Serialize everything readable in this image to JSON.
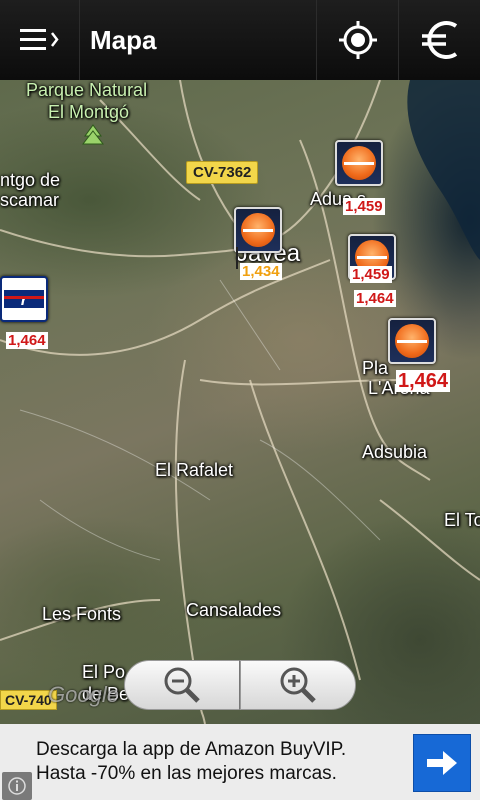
{
  "actionbar": {
    "title": "Mapa",
    "menu_icon": "menu-drawer-icon",
    "locate_icon": "my-location-icon",
    "currency_icon": "euro-icon"
  },
  "map": {
    "places": {
      "parque_line1": "Parque Natural",
      "parque_line2": "El Montgó",
      "montgo_line1": "ntgo de",
      "montgo_line2": "scamar",
      "adsubia": "Adsubia",
      "el_rafalet": "El Rafalet",
      "el_tos": "El To",
      "les_fonts": "Les Fonts",
      "cansalades": "Cansalades",
      "el_pou_line1": "El Po",
      "el_pou_line2": "de Be",
      "javea": "Jávea",
      "aduanas": "Adua  s",
      "playa_line1": "Pla",
      "playa_line2": "L'Arena"
    },
    "roads": {
      "cv7362": "CV-7362",
      "cv740": "CV-740"
    },
    "stations": [
      {
        "brand": "Repsol",
        "price": "1,459"
      },
      {
        "brand": "Repsol",
        "price": "1,434"
      },
      {
        "brand": "Repsol",
        "price": "1,459"
      },
      {
        "brand": "Repsol",
        "price": "1,464"
      },
      {
        "brand": "Repsol",
        "price": "1,464"
      },
      {
        "brand": "Repsol",
        "price": "1,464"
      }
    ],
    "attribution": "Google",
    "zoom_out_icon": "zoom-out-icon",
    "zoom_in_icon": "zoom-in-icon"
  },
  "ad": {
    "line1": "Descarga la app de Amazon BuyVIP.",
    "line2": "Hasta -70% en las mejores marcas.",
    "arrow_icon": "arrow-right-icon",
    "info_icon": "info-icon"
  },
  "colors": {
    "accent_ad": "#1769d6",
    "price_red": "#d01818",
    "price_orange": "#f0a010"
  }
}
